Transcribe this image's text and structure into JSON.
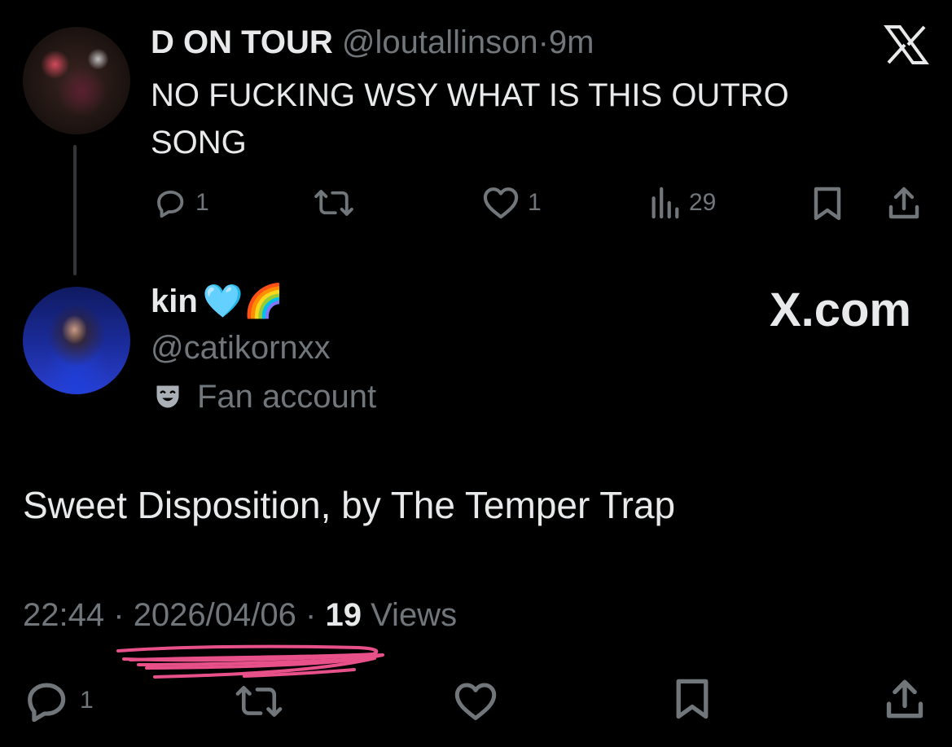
{
  "parent_tweet": {
    "display_name": "D ON TOUR",
    "handle": "@loutallinson",
    "separator": "·",
    "time_ago": "9m",
    "text": "NO FUCKING WSY WHAT IS THIS OUTRO SONG",
    "actions": {
      "replies": "1",
      "likes": "1",
      "views": "29"
    }
  },
  "reply_tweet": {
    "display_name": "kin",
    "name_emojis": "🩵🌈",
    "handle": "@catikornxx",
    "account_label": "Fan account",
    "text": "Sweet Disposition, by The Temper Trap",
    "time": "22:44",
    "date": "2026/04/06",
    "separator": "·",
    "views_count": "19",
    "views_label": "Views",
    "actions": {
      "replies": "1"
    }
  },
  "branding": {
    "x_logo_text": "X.com",
    "x_icon": "x-logo-icon"
  },
  "colors": {
    "background": "#000000",
    "primary_text": "#e7e9ea",
    "secondary_text": "#71767b",
    "scribble": "#e8508a"
  }
}
